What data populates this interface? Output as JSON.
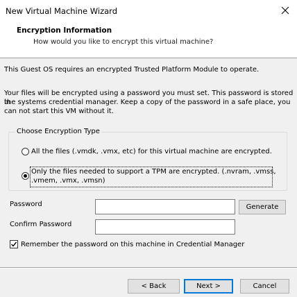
{
  "window": {
    "title": "New Virtual Machine Wizard",
    "close_icon": "close-icon"
  },
  "header": {
    "title": "Encryption Information",
    "subtitle": "How would you like to encrypt this virtual machine?"
  },
  "body": {
    "tpm_notice": "This Guest OS requires an encrypted Trusted Platform Module to operate.",
    "password_info_line1": "Your files will be encrypted using a password you must set. This password is stored in",
    "password_info_line2": "the systems credential manager. Keep a copy of the password in a safe place, you",
    "password_info_line3": "can not start this VM without it."
  },
  "encryption_type": {
    "group_label": "Choose Encryption Type",
    "option_all": "All the files (.vmdk, .vmx, etc) for this virtual machine are encrypted.",
    "option_tpm_line1": "Only the files needed to support a TPM are encrypted. (.nvram, .vmss,",
    "option_tpm_line2": ".vmem, .vmx, .vmsn)",
    "selected": "tpm"
  },
  "password": {
    "label": "Password",
    "value": "",
    "generate_label": "Generate",
    "confirm_label": "Confirm Password",
    "confirm_value": ""
  },
  "remember": {
    "label": "Remember the password on this machine in Credential Manager",
    "checked": true
  },
  "footer": {
    "back_label": "< Back",
    "next_label": "Next >",
    "cancel_label": "Cancel"
  },
  "colors": {
    "default_button_border": "#0078d7",
    "dialog_background": "#f0f0f0"
  }
}
